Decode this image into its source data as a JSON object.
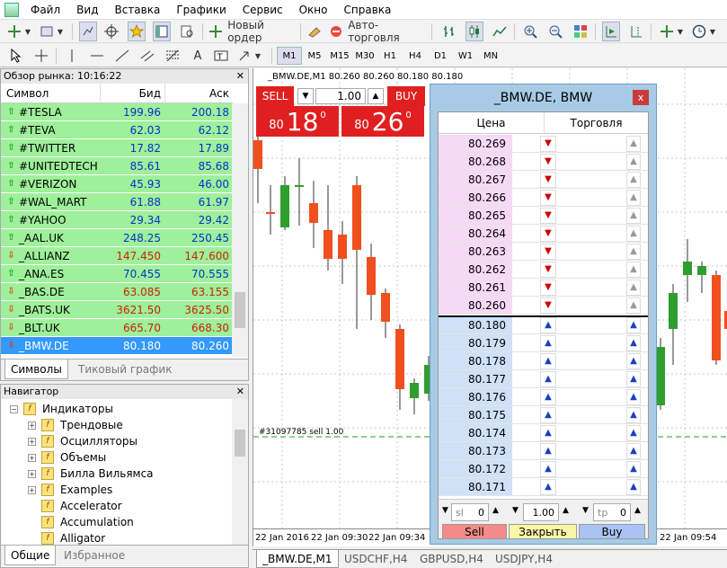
{
  "menu": [
    "Файл",
    "Вид",
    "Вставка",
    "Графики",
    "Сервис",
    "Окно",
    "Справка"
  ],
  "toolbar": {
    "new_order": "Новый ордер",
    "auto_trading": "Авто-торговля"
  },
  "timeframes": [
    "M1",
    "M5",
    "M15",
    "M30",
    "H1",
    "H4",
    "D1",
    "W1",
    "MN"
  ],
  "market_watch": {
    "title": "Обзор рынка: 10:16:22",
    "columns": {
      "symbol": "Символ",
      "bid": "Бид",
      "ask": "Аск"
    },
    "rows": [
      {
        "symbol": "#TESLA",
        "bid": "199.96",
        "ask": "200.18",
        "dir": "up"
      },
      {
        "symbol": "#TEVA",
        "bid": "62.03",
        "ask": "62.12",
        "dir": "up"
      },
      {
        "symbol": "#TWITTER",
        "bid": "17.82",
        "ask": "17.89",
        "dir": "up"
      },
      {
        "symbol": "#UNITEDTECH",
        "bid": "85.61",
        "ask": "85.68",
        "dir": "up"
      },
      {
        "symbol": "#VERIZON",
        "bid": "45.93",
        "ask": "46.00",
        "dir": "up"
      },
      {
        "symbol": "#WAL_MART",
        "bid": "61.88",
        "ask": "61.97",
        "dir": "up"
      },
      {
        "symbol": "#YAHOO",
        "bid": "29.34",
        "ask": "29.42",
        "dir": "up"
      },
      {
        "symbol": "_AAL.UK",
        "bid": "248.25",
        "ask": "250.45",
        "dir": "up"
      },
      {
        "symbol": "_ALLIANZ",
        "bid": "147.450",
        "ask": "147.600",
        "dir": "dn"
      },
      {
        "symbol": "_ANA.ES",
        "bid": "70.455",
        "ask": "70.555",
        "dir": "up"
      },
      {
        "symbol": "_BAS.DE",
        "bid": "63.085",
        "ask": "63.155",
        "dir": "dn"
      },
      {
        "symbol": "_BATS.UK",
        "bid": "3621.50",
        "ask": "3625.50",
        "dir": "dn"
      },
      {
        "symbol": "_BLT.UK",
        "bid": "665.70",
        "ask": "668.30",
        "dir": "dn"
      },
      {
        "symbol": "_BMW.DE",
        "bid": "80.180",
        "ask": "80.260",
        "dir": "dn",
        "selected": true
      }
    ],
    "tabs": [
      "Символы",
      "Тиковый график"
    ]
  },
  "navigator": {
    "title": "Навигатор",
    "root": "Индикаторы",
    "folders": [
      "Трендовые",
      "Осцилляторы",
      "Объемы",
      "Билла Вильямса",
      "Examples"
    ],
    "indicators": [
      "Accelerator",
      "Accumulation",
      "Alligator"
    ],
    "tabs": [
      "Общие",
      "Избранное"
    ]
  },
  "chart": {
    "title": "_BMW.DE,M1  80.260 80.260 80.180 80.180",
    "order_line": "#31097785 sell 1.00",
    "x_labels": [
      "22 Jan 2016",
      "22 Jan 09:30",
      "22 Jan 09:34",
      "22 Jan 09:54"
    ],
    "tabs": [
      "_BMW.DE,M1",
      "USDCHF,H4",
      "GBPUSD,H4",
      "USDJPY,H4"
    ]
  },
  "one_click": {
    "sell": "SELL",
    "buy": "BUY",
    "volume": "1.00",
    "sell_small": "80",
    "sell_big": "18",
    "sell_pts": "0",
    "buy_small": "80",
    "buy_big": "26",
    "buy_pts": "0"
  },
  "dom": {
    "title": "_BMW.DE, BMW",
    "close": "x",
    "col_price": "Цена",
    "col_trade": "Торговля",
    "asks": [
      "80.269",
      "80.268",
      "80.267",
      "80.266",
      "80.265",
      "80.264",
      "80.263",
      "80.262",
      "80.261",
      "80.260"
    ],
    "bids": [
      "80.180",
      "80.179",
      "80.178",
      "80.177",
      "80.176",
      "80.175",
      "80.174",
      "80.173",
      "80.172",
      "80.171"
    ],
    "sl_label": "sl",
    "sl_value": "0",
    "volume": "1.00",
    "tp_label": "tp",
    "tp_value": "0",
    "sell": "Sell",
    "close_btn": "Закрыть",
    "buy": "Buy"
  },
  "colors": {
    "bull": "#2e9e2e",
    "bear": "#f0501e",
    "ask_bg": "#f6d9f4",
    "bid_bg": "#cfe0f7",
    "selected": "#3399ff",
    "mw_row": "#9ef09a"
  }
}
